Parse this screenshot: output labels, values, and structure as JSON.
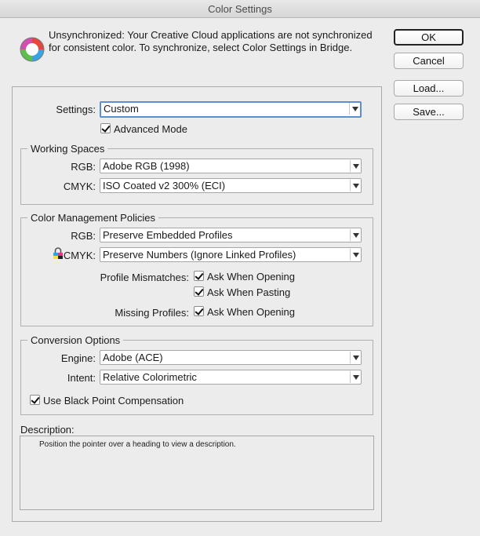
{
  "window": {
    "title": "Color Settings"
  },
  "warning": {
    "icon": "creative-cloud-color-wheel-icon",
    "text": "Unsynchronized: Your Creative Cloud applications are not synchronized for consistent color. To synchronize, select Color Settings in Bridge."
  },
  "buttons": {
    "ok": "OK",
    "cancel": "Cancel",
    "load": "Load...",
    "save": "Save..."
  },
  "settings": {
    "label": "Settings:",
    "value": "Custom",
    "advanced_mode_label": "Advanced Mode",
    "advanced_mode_checked": true
  },
  "working_spaces": {
    "title": "Working Spaces",
    "rgb_label": "RGB:",
    "rgb_value": "Adobe RGB (1998)",
    "cmyk_label": "CMYK:",
    "cmyk_value": "ISO Coated v2 300% (ECI)"
  },
  "policies": {
    "title": "Color Management Policies",
    "rgb_label": "RGB:",
    "rgb_value": "Preserve Embedded Profiles",
    "cmyk_label": "CMYK:",
    "cmyk_value": "Preserve Numbers (Ignore Linked Profiles)",
    "cmyk_icon": "lock-icon",
    "profile_mismatches_label": "Profile Mismatches:",
    "ask_when_opening": "Ask When Opening",
    "ask_when_pasting": "Ask When Pasting",
    "missing_profiles_label": "Missing Profiles:",
    "missing_ask_when_opening": "Ask When Opening"
  },
  "conversion": {
    "title": "Conversion Options",
    "engine_label": "Engine:",
    "engine_value": "Adobe (ACE)",
    "intent_label": "Intent:",
    "intent_value": "Relative Colorimetric",
    "black_point_label": "Use Black Point Compensation",
    "black_point_checked": true
  },
  "description": {
    "label": "Description:",
    "text": "Position the pointer over a heading to view a description."
  },
  "colors": {
    "background": "#ececec",
    "focus_ring": "#5a8fd6"
  }
}
